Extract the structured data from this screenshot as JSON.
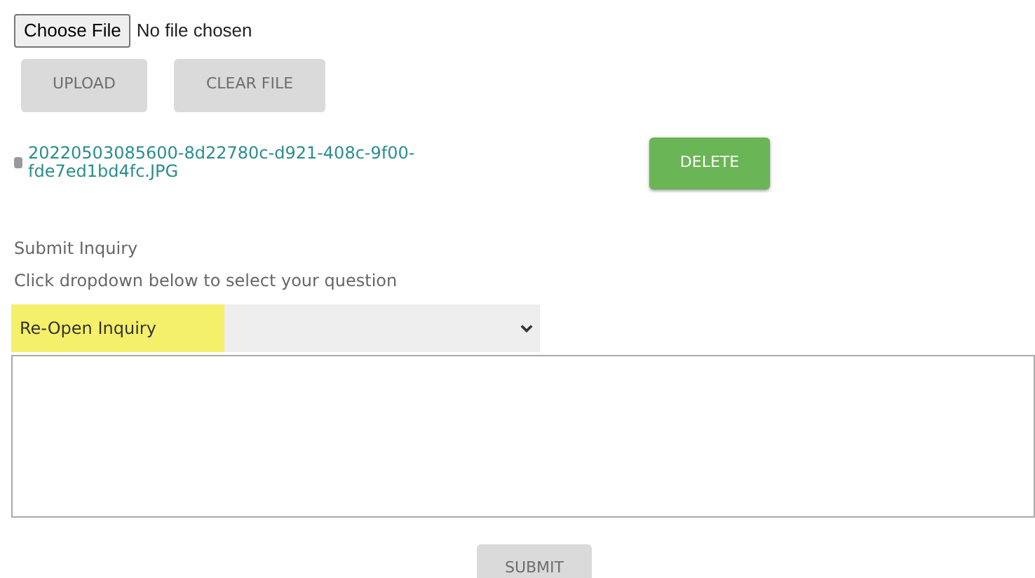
{
  "file_picker": {
    "button": "Choose File",
    "status": "No file chosen"
  },
  "file_buttons": [
    {
      "label": "UPLOAD",
      "disabled": true
    },
    {
      "label": "CLEAR FILE",
      "disabled": true
    }
  ],
  "attachment": {
    "name": "20220503085600-8d22780c-d921-408c-9f00-fde7ed1bd4fc.JPG",
    "delete": {
      "label": "DELETE",
      "disabled": false
    }
  },
  "inquiry": {
    "title": "Submit Inquiry",
    "hint": "Click dropdown below to select your question",
    "select": {
      "value": "Re-Open Inquiry",
      "highlighted": true
    },
    "submit": {
      "label": "SUBMIT",
      "disabled": true
    }
  }
}
